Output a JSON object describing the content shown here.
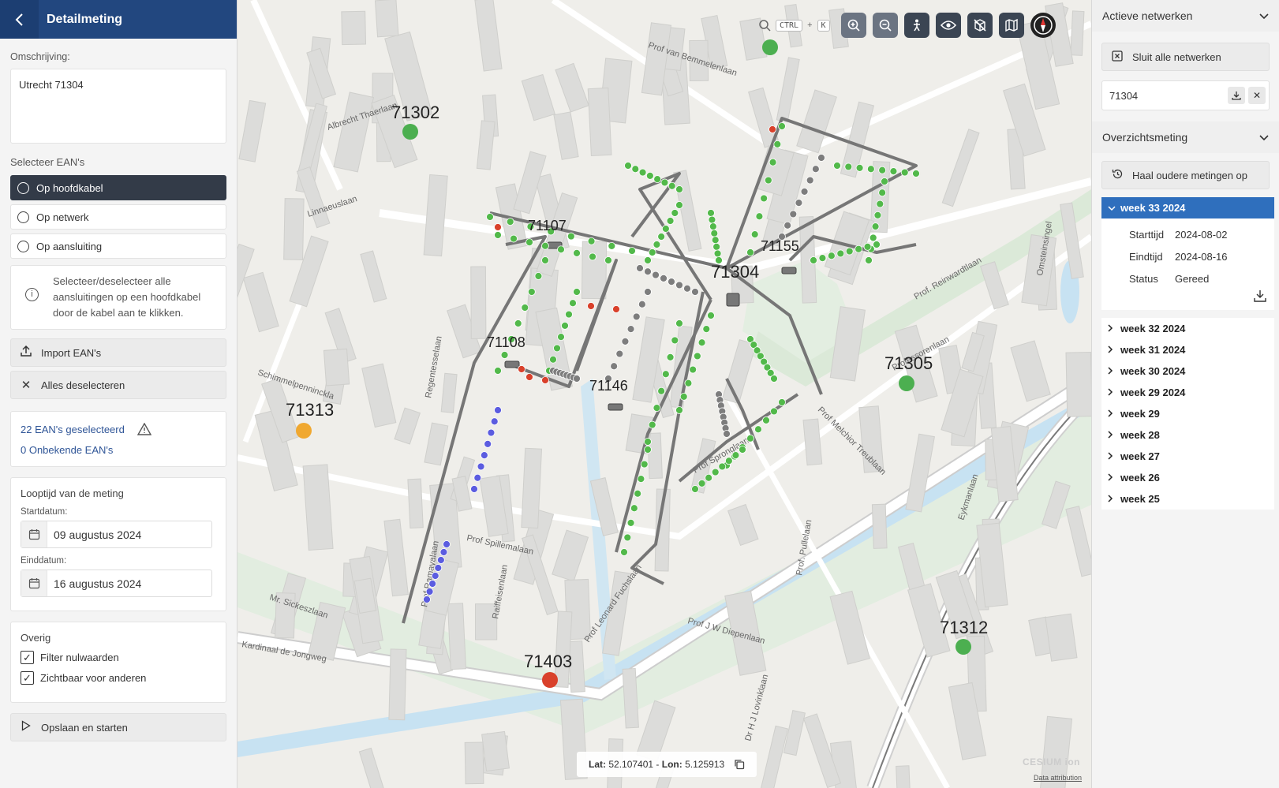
{
  "left": {
    "title": "Detailmeting",
    "description_label": "Omschrijving:",
    "description_value": "Utrecht 71304",
    "select_label": "Selecteer EAN's",
    "options": [
      "Op hoofdkabel",
      "Op netwerk",
      "Op aansluiting"
    ],
    "info_text": "Selecteer/deselecteer alle aansluitingen op een hoofdkabel door de kabel aan te klikken.",
    "import_label": "Import EAN's",
    "deselect_label": "Alles deselecteren",
    "selected_count": "22 EAN's geselecteerd",
    "unknown_count": "0 Onbekende EAN's",
    "duration_title": "Looptijd van de meting",
    "start_label": "Startdatum:",
    "start_value": "09 augustus 2024",
    "end_label": "Einddatum:",
    "end_value": "16 augustus 2024",
    "other_title": "Overig",
    "chk_filter": "Filter nulwaarden",
    "chk_visible": "Zichtbaar voor anderen",
    "save_label": "Opslaan en starten"
  },
  "map": {
    "kbd_ctrl": "CTRL",
    "kbd_plus": "+",
    "kbd_k": "K",
    "coord_lat_label": "Lat:",
    "coord_lat": "52.107401",
    "coord_sep": " - ",
    "coord_lon_label": "Lon:",
    "coord_lon": "5.125913",
    "attribution": "Data attribution",
    "cesium": "CESIUM ion",
    "stations": [
      "71302",
      "71107",
      "71155",
      "71304",
      "71108",
      "71146",
      "71313",
      "71305",
      "71312",
      "71403"
    ],
    "streets": [
      "Prof van Bemmelenlaan",
      "Albrecht Thaerlaan",
      "Linnaeuslaan",
      "Prof. Reinwardtlaan",
      "Professorenlaan",
      "Prof Melchior Treublaan",
      "Prof Spronglaan",
      "Prof Spillemalaan",
      "Mr. Sickeszlaan",
      "Kardinaal de Jongweg",
      "Prof J W Diepenlaan",
      "Eykmanlaan",
      "Regentesselaan",
      "Schimmelpenninckla",
      "Prof Ramayalaan",
      "Raiffeisenlaan",
      "Prof Leonard Fuchslaan",
      "Dr H J Lovinklaan",
      "Prof. Pullelaan",
      "Omsteinsingel"
    ]
  },
  "right": {
    "active_title": "Actieve netwerken",
    "close_all": "Sluit alle netwerken",
    "network": "71304",
    "overview_title": "Overzichtsmeting",
    "fetch_older": "Haal oudere metingen op",
    "open_week": "week 33 2024",
    "details": {
      "start_key": "Starttijd",
      "start_val": "2024-08-02",
      "end_key": "Eindtijd",
      "end_val": "2024-08-16",
      "status_key": "Status",
      "status_val": "Gereed"
    },
    "weeks": [
      "week 32 2024",
      "week 31 2024",
      "week 30 2024",
      "week 29 2024",
      "week 29",
      "week 28",
      "week 27",
      "week 26",
      "week 25"
    ]
  }
}
